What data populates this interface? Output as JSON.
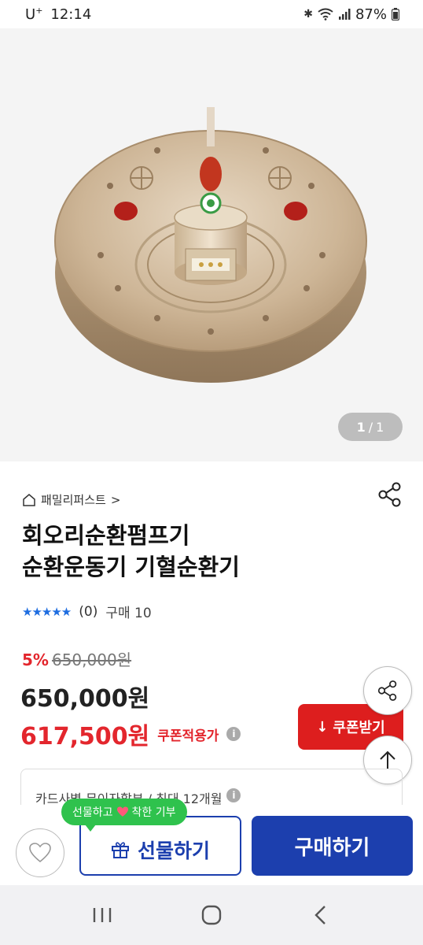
{
  "status_bar": {
    "carrier": "U",
    "carrier_sup": "+",
    "time": "12:14",
    "battery": "87%"
  },
  "product_image": {
    "page_current": "1",
    "page_sep": "/",
    "page_total": "1"
  },
  "store": {
    "name": "패밀리퍼스트",
    "chevron": ">"
  },
  "title": {
    "line1": "회오리순환펌프기",
    "line2": "순환운동기 기혈순환기"
  },
  "rating": {
    "stars": "★★★★★",
    "review_count": "(0)",
    "purchase": "구매 10"
  },
  "price": {
    "discount_rate": "5%",
    "original_price": "650,000원",
    "sale_price": "650,000원",
    "coupon_price": "617,500원",
    "coupon_label": "쿠폰적용가",
    "info": "i"
  },
  "coupon_button": {
    "icon": "↓",
    "label": "쿠폰받기"
  },
  "card_benefit": {
    "text": "카드사별 무이자할부 / 최대 12개월",
    "info": "i"
  },
  "bottom_bar": {
    "tooltip_left": "선물하고",
    "tooltip_right": "착한 기부",
    "gift_label": "선물하기",
    "buy_label": "구매하기"
  },
  "colors": {
    "accent_blue": "#1c3fae",
    "accent_red": "#dd1e1e",
    "price_red": "#e3262d",
    "tooltip_green": "#2fc24d",
    "star_blue": "#1e6de0"
  }
}
